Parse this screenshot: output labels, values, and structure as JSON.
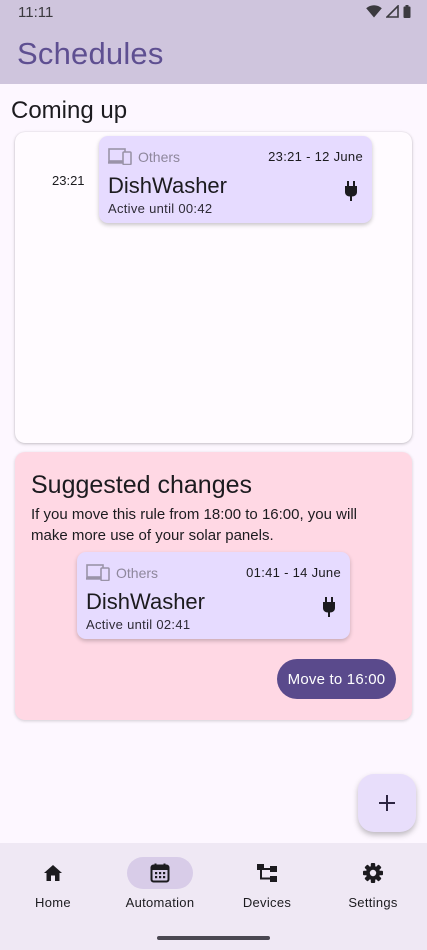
{
  "status_bar": {
    "time": "11:11"
  },
  "app_bar": {
    "title": "Schedules"
  },
  "coming_up": {
    "title": "Coming up",
    "time_label": "23:21",
    "rule": {
      "category": "Others",
      "when": "23:21 - 12 June",
      "device": "DishWasher",
      "active_until": "Active until 00:42"
    }
  },
  "suggested": {
    "title": "Suggested changes",
    "body": "If you move this rule from 18:00 to 16:00, you will make more use of your solar panels.",
    "rule": {
      "category": "Others",
      "when": "01:41 - 14 June",
      "device": "DishWasher",
      "active_until": "Active until 02:41"
    },
    "button_label": "Move to 16:00"
  },
  "fab": {
    "icon": "plus-icon",
    "label": "+"
  },
  "nav": {
    "items": [
      {
        "label": "Home",
        "icon": "home-icon"
      },
      {
        "label": "Automation",
        "icon": "calendar-icon",
        "active": true
      },
      {
        "label": "Devices",
        "icon": "device-hub-icon"
      },
      {
        "label": "Settings",
        "icon": "gear-icon"
      }
    ]
  },
  "colors": {
    "app_bar_bg": "#cfc5dd",
    "title_color": "#5e4f91",
    "rule_card_bg": "#e6dbff",
    "suggest_bg": "#ffd8e4",
    "primary_button": "#5a4a8c"
  }
}
